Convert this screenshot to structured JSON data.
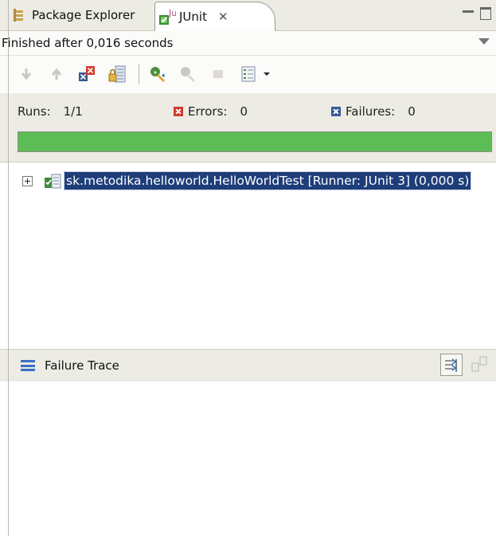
{
  "tabs": [
    {
      "label": "Package Explorer",
      "icon": "package-explorer-icon",
      "active": false
    },
    {
      "label": "JUnit",
      "icon": "junit-icon",
      "active": true,
      "close": "✕"
    }
  ],
  "status": {
    "text": "Finished after 0,016 seconds"
  },
  "toolbar": {
    "buttons": [
      "next-failure-icon",
      "previous-failure-icon",
      "show-failures-only-icon",
      "scroll-lock-icon",
      "rerun-test-icon",
      "rerun-failed-first-icon",
      "stop-icon",
      "test-run-history-icon",
      "history-dropdown-icon"
    ]
  },
  "counters": {
    "runs_label": "Runs:",
    "runs_value": "1/1",
    "errors_label": "Errors:",
    "errors_value": "0",
    "failures_label": "Failures:",
    "failures_value": "0"
  },
  "progress": {
    "fraction": 1.0,
    "color": "#5cbd56"
  },
  "tree": {
    "items": [
      {
        "label": "sk.metodika.helloworld.HelloWorldTest [Runner: JUnit 3] (0,000 s)",
        "selected": true
      }
    ]
  },
  "failure_trace": {
    "title": "Failure Trace"
  },
  "colors": {
    "selection": "#1e3e7a",
    "error": "#d33a2f",
    "failure": "#3b5a9c",
    "chrome": "#ecebe4"
  }
}
